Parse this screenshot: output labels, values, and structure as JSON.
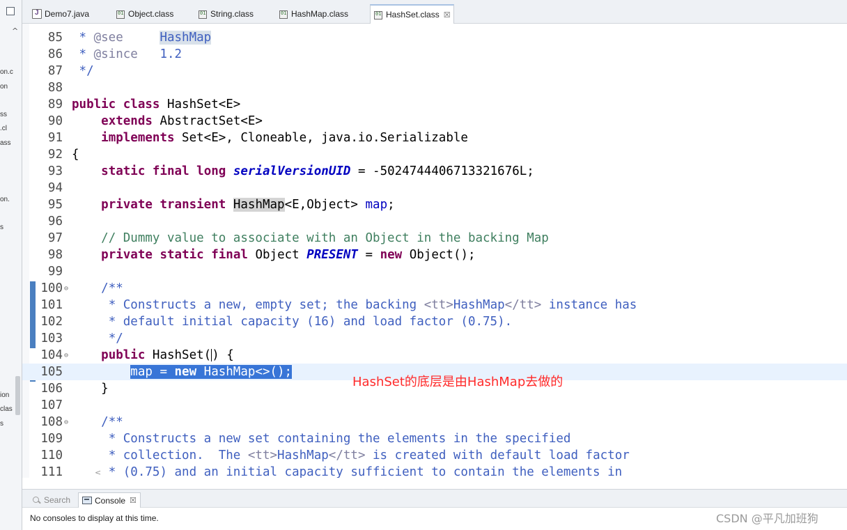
{
  "tabs": [
    {
      "label": "Demo7.java",
      "icon": "java-file-icon",
      "active": false
    },
    {
      "label": "Object.class",
      "icon": "class-file-icon",
      "active": false
    },
    {
      "label": "String.class",
      "icon": "class-file-icon",
      "active": false
    },
    {
      "label": "HashMap.class",
      "icon": "class-file-icon",
      "active": false
    },
    {
      "label": "HashSet.class",
      "icon": "class-file-icon",
      "active": true,
      "close": "☒"
    }
  ],
  "left_panel": {
    "fragments": [
      "on.c",
      "on",
      "ss",
      ".cl",
      "ass",
      "on.",
      "s",
      "ion",
      "clas",
      "s"
    ]
  },
  "editor": {
    "line_numbers": [
      "85",
      "86",
      "87",
      "88",
      "89",
      "90",
      "91",
      "92",
      "93",
      "94",
      "95",
      "96",
      "97",
      "98",
      "99",
      "100",
      "101",
      "102",
      "103",
      "104",
      "105",
      "106",
      "107",
      "108",
      "109",
      "110",
      "111"
    ],
    "line_85": {
      "star": " * ",
      "tag": "@see",
      "space": "     ",
      "ref": "HashMap"
    },
    "line_86": {
      "star": " * ",
      "tag": "@since",
      "space": "   ",
      "ver": "1.2"
    },
    "line_87": {
      "text": " */"
    },
    "line_89": {
      "kw1": "public",
      "kw2": "class",
      "rest": " HashSet<E>"
    },
    "line_90": {
      "indent": "    ",
      "kw": "extends",
      "rest": " AbstractSet<E>"
    },
    "line_91": {
      "indent": "    ",
      "kw": "implements",
      "rest": " Set<E>, Cloneable, java.io.Serializable"
    },
    "line_92": {
      "text": "{"
    },
    "line_93": {
      "indent": "    ",
      "kw1": "static",
      "kw2": "final",
      "kw3": "long",
      "field": "serialVersionUID",
      "rest": " = -5024744406713321676L;"
    },
    "line_95": {
      "indent": "    ",
      "kw1": "private",
      "kw2": "transient",
      "type": "HashMap",
      "generic": "<E,Object> ",
      "field": "map",
      "end": ";"
    },
    "line_97": {
      "indent": "    ",
      "comment": "// Dummy value to associate with an Object in the backing Map"
    },
    "line_98": {
      "indent": "    ",
      "kw1": "private",
      "kw2": "static",
      "kw3": "final",
      "type": " Object ",
      "field": "PRESENT",
      "mid": " = ",
      "kw4": "new",
      "rest": " Object();"
    },
    "line_100": {
      "indent": "    ",
      "text": "/**"
    },
    "line_101": {
      "indent": "     ",
      "p1": "* Constructs a new, empty set; the backing ",
      "t1": "<tt>",
      "p2": "HashMap",
      "t2": "</tt>",
      "p3": " instance has"
    },
    "line_102": {
      "indent": "     ",
      "text": "* default initial capacity (16) and load factor (0.75)."
    },
    "line_103": {
      "indent": "     ",
      "text": "*/"
    },
    "line_104": {
      "indent": "    ",
      "kw": "public",
      "rest1": " HashSet(",
      "rest2": ") {"
    },
    "line_105": {
      "indent": "        ",
      "field": "map",
      "mid": " = ",
      "kw": "new",
      "rest": " HashMap<>();"
    },
    "line_106": {
      "indent": "    ",
      "text": "}"
    },
    "line_108": {
      "indent": "    ",
      "text": "/**"
    },
    "line_109": {
      "indent": "     ",
      "text": "* Constructs a new set containing the elements in the specified"
    },
    "line_110": {
      "indent": "     ",
      "p1": "* collection.  The ",
      "t1": "<tt>",
      "p2": "HashMap",
      "t2": "</tt>",
      "p3": " is created with default load factor"
    },
    "line_111": {
      "indent": "     ",
      "text": "* (0.75) and an initial capacity sufficient to contain the elements in"
    },
    "fold_marker": "⊖",
    "scroll_arrow": "<"
  },
  "annotation": "HashSet的底层是由HashMap去做的",
  "bottom_panel": {
    "search_tab": "Search",
    "console_tab": "Console",
    "console_close": "☒",
    "message": "No consoles to display at this time."
  },
  "watermark": "CSDN @平凡加班狗",
  "colors": {
    "keyword": "#7f0055",
    "comment": "#3f7f5f",
    "javadoc": "#3f5fbf",
    "field": "#0000c0",
    "selection": "#3875d7",
    "annotation": "#ff2a2a"
  }
}
